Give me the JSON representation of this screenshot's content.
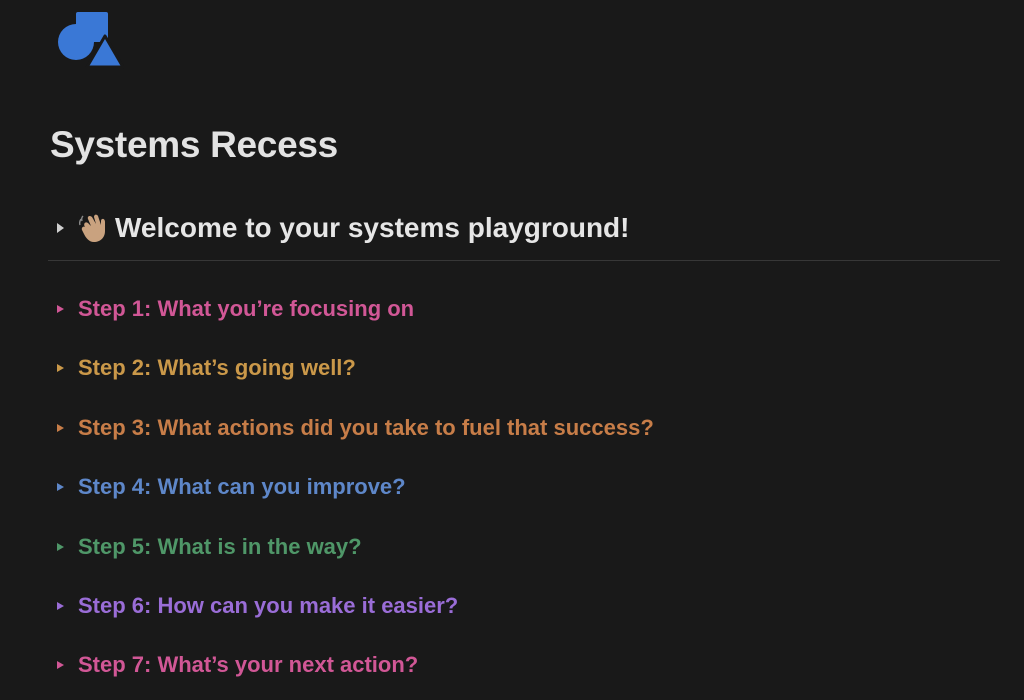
{
  "page": {
    "icon": "shapes-icon",
    "title": "Systems Recess"
  },
  "welcome_toggle": {
    "emoji": "waving-hand-icon",
    "label": "Welcome to your systems playground!"
  },
  "steps": [
    {
      "label": "Step 1: What you’re focusing on",
      "color": "#d15796"
    },
    {
      "label": "Step 2: What’s going well?",
      "color": "#ca9849"
    },
    {
      "label": "Step 3: What actions did you take to fuel that success?",
      "color": "#c77d48"
    },
    {
      "label": "Step 4: What can you improve?",
      "color": "#5e87c9"
    },
    {
      "label": "Step 5: What is in the way?",
      "color": "#4f9768"
    },
    {
      "label": "Step 6: How can you make it easier?",
      "color": "#9a6dd7"
    },
    {
      "label": "Step 7: What’s your next action?",
      "color": "#d15796"
    }
  ],
  "colors": {
    "background": "#191919",
    "icon_blue": "#3a78d6"
  }
}
